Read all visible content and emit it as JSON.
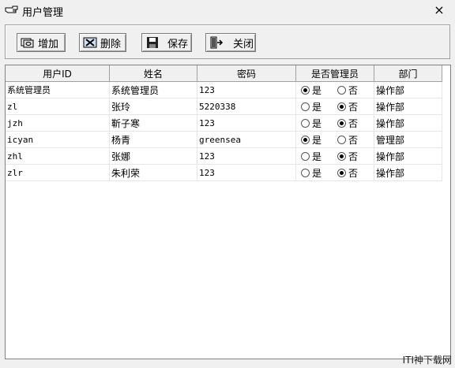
{
  "window": {
    "title": "用户管理",
    "close": "×"
  },
  "toolbar": {
    "add": "增加",
    "delete": "删除",
    "save": "保存",
    "close": "关闭"
  },
  "table": {
    "headers": [
      "用户ID",
      "姓名",
      "密码",
      "是否管理员",
      "部门"
    ],
    "radio_yes": "是",
    "radio_no": "否",
    "rows": [
      {
        "id": "系统管理员",
        "name": "系统管理员",
        "password": "123",
        "admin": true,
        "dept": "操作部"
      },
      {
        "id": "zl",
        "name": "张玲",
        "password": "5220338",
        "admin": false,
        "dept": "操作部"
      },
      {
        "id": "jzh",
        "name": "靳子寒",
        "password": "123",
        "admin": false,
        "dept": "操作部"
      },
      {
        "id": "icyan",
        "name": "杨青",
        "password": "greensea",
        "admin": true,
        "dept": "管理部"
      },
      {
        "id": "zhl",
        "name": "张娜",
        "password": "123",
        "admin": false,
        "dept": "操作部"
      },
      {
        "id": "zlr",
        "name": "朱利荣",
        "password": "123",
        "admin": false,
        "dept": "操作部"
      }
    ]
  },
  "watermark": "ITI神下载网"
}
